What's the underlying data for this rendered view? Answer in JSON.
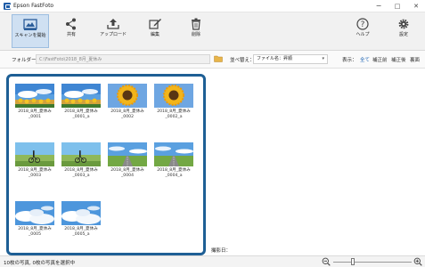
{
  "window": {
    "title": "Epson FastFoto",
    "minimize_glyph": "−",
    "maximize_glyph": "□",
    "close_glyph": "✕"
  },
  "toolbar": {
    "scan": "スキャンを開始",
    "share": "共有",
    "upload": "アップロード",
    "edit": "編集",
    "delete": "削除",
    "help": "ヘルプ",
    "settings": "設定"
  },
  "folder": {
    "label": "フォルダー：",
    "path": "C:\\FastFoto\\2018_8月_夏休み"
  },
  "sort": {
    "label": "並べ替え：",
    "value": "ファイル名：昇順"
  },
  "view": {
    "label": "表示：",
    "filters": [
      "全て",
      "補正前",
      "補正後",
      "裏面"
    ],
    "active": "全て"
  },
  "photos": [
    {
      "line1": "2018_8月_夏休み",
      "line2": "_0001",
      "scene": "sky"
    },
    {
      "line1": "2018_8月_夏休み",
      "line2": "_0001_a",
      "scene": "sky"
    },
    {
      "line1": "2018_8月_夏休み",
      "line2": "_0002",
      "scene": "sunflower"
    },
    {
      "line1": "2018_8月_夏休み",
      "line2": "_0002_a",
      "scene": "sunflower"
    },
    {
      "line1": "2018_8月_夏休み",
      "line2": "_0003",
      "scene": "cyclist"
    },
    {
      "line1": "2018_8月_夏休み",
      "line2": "_0003_a",
      "scene": "cyclist"
    },
    {
      "line1": "2018_8月_夏休み",
      "line2": "_0004",
      "scene": "road"
    },
    {
      "line1": "2018_8月_夏休み",
      "line2": "_0004_a",
      "scene": "road"
    },
    {
      "line1": "2018_8月_夏休み",
      "line2": "_0005",
      "scene": "clouds"
    },
    {
      "line1": "2018_8月_夏休み",
      "line2": "_0005_a",
      "scene": "clouds"
    }
  ],
  "details": {
    "date_label": "撮影日："
  },
  "status": {
    "text": "10枚の写真, 0枚の写真を選択中",
    "zoom_level": 0.25
  },
  "colors": {
    "accent": "#2166b5",
    "selection_border": "#1e5f95"
  }
}
